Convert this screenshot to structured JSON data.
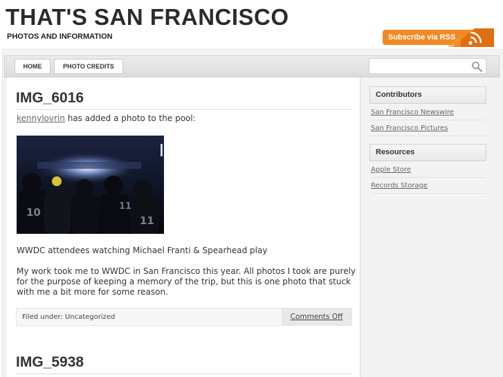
{
  "header": {
    "title": "THAT'S SAN FRANCISCO",
    "tagline": "PHOTOS AND INFORMATION",
    "rss_label": "Subscribe via RSS"
  },
  "nav": {
    "items": [
      {
        "label": "HOME"
      },
      {
        "label": "PHOTO CREDITS"
      }
    ],
    "search": {
      "value": "",
      "placeholder": ""
    }
  },
  "posts": [
    {
      "title": "IMG_6016",
      "author": "kennylovrin",
      "byline_text": " has added a photo to the pool:",
      "photo_icon": "photo-image",
      "caption": "WWDC attendees watching Michael Franti & Spearhead play",
      "body": "My work took me to WWDC in San Francisco this year. All photos I took are purely for the purpose of keeping a memory of the trip, but this is one photo that stuck with me a bit more for some reason.",
      "filed_under": "Filed under: Uncategorized",
      "comments": "Comments Off"
    },
    {
      "title": "IMG_5938"
    }
  ],
  "sidebar": {
    "widgets": [
      {
        "title": "Contributors",
        "links": [
          "San Francisco Newswire",
          "San Francisco Pictures"
        ]
      },
      {
        "title": "Resources",
        "links": [
          "Apple Store",
          "Records Storage"
        ]
      }
    ]
  },
  "colors": {
    "rss_orange": "#f08a24",
    "link_gray": "#666666",
    "title_dark": "#2b2b2b"
  }
}
